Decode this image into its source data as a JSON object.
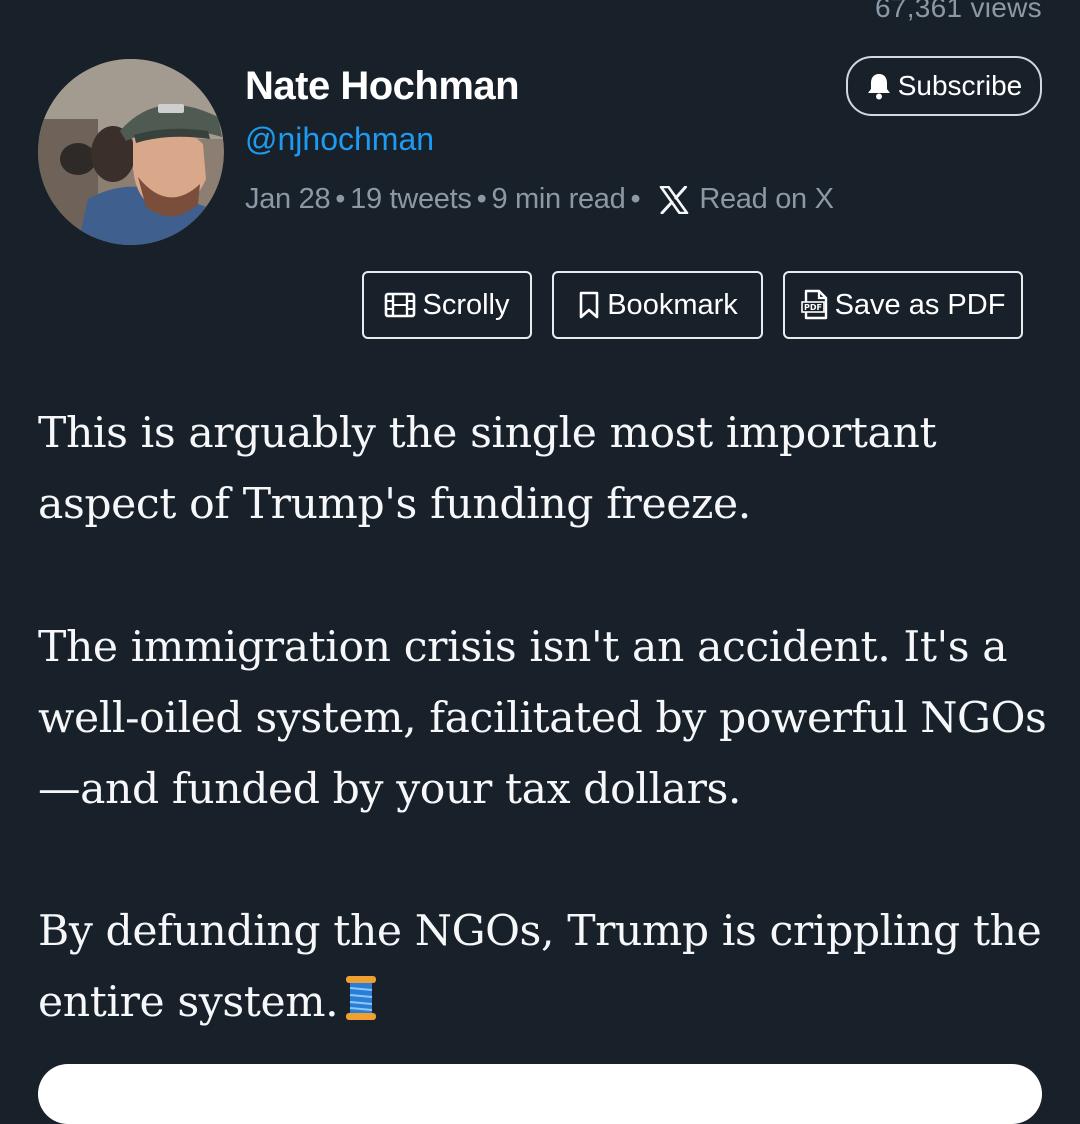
{
  "stats": {
    "views": "67,361 views"
  },
  "author": {
    "name": "Nate Hochman",
    "handle": "@njhochman"
  },
  "meta": {
    "date": "Jan 28",
    "tweets": "19 tweets",
    "read_time": "9 min read",
    "read_on_x": "Read on X",
    "separator": "•"
  },
  "subscribe": {
    "label": "Subscribe",
    "icon": "bell-icon"
  },
  "actions": {
    "scrolly": {
      "label": "Scrolly",
      "icon": "film-icon"
    },
    "bookmark": {
      "label": "Bookmark",
      "icon": "bookmark-icon"
    },
    "save_pdf": {
      "label": "Save as PDF",
      "icon": "pdf-icon"
    }
  },
  "tweet": {
    "paragraphs": [
      "This is arguably the single most important aspect of Trump's funding freeze.",
      "The immigration crisis isn't an accident. It's a well-oiled system, facilitated by powerful NGOs—and funded by your tax dollars.",
      "By defunding the NGOs, Trump is crippling the entire system."
    ],
    "thread_emoji_icon": "spool-of-thread-icon"
  },
  "colors": {
    "background": "#18202a",
    "text": "#f5f7f9",
    "muted": "#8b98a5",
    "link": "#1d9bf0"
  }
}
